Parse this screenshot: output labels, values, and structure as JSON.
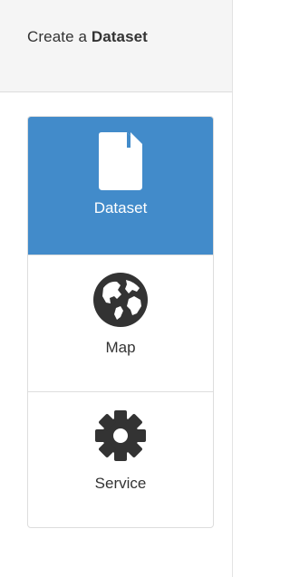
{
  "header": {
    "title_prefix": "Create a ",
    "title_bold": "Dataset"
  },
  "types": [
    {
      "label": "Dataset",
      "icon": "document-icon",
      "selected": true
    },
    {
      "label": "Map",
      "icon": "globe-icon",
      "selected": false
    },
    {
      "label": "Service",
      "icon": "gear-icon",
      "selected": false
    }
  ],
  "colors": {
    "active_background": "#428bca",
    "active_text": "#ffffff",
    "icon_dark": "#333333",
    "header_background": "#f5f5f5"
  }
}
